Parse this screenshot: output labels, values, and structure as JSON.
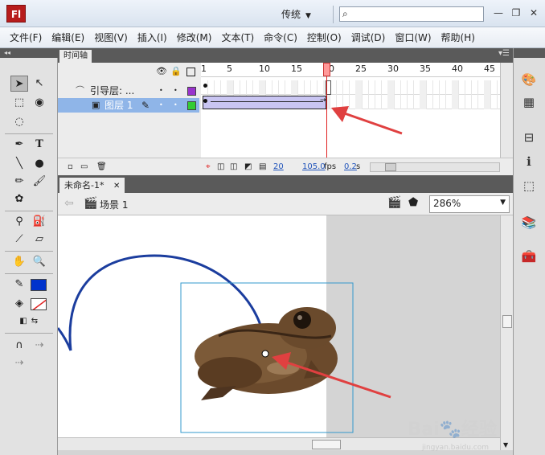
{
  "app": {
    "logo": "Fl",
    "workspace": "传统",
    "search_placeholder": ""
  },
  "menu": [
    "文件(F)",
    "编辑(E)",
    "视图(V)",
    "插入(I)",
    "修改(M)",
    "文本(T)",
    "命令(C)",
    "控制(O)",
    "调试(D)",
    "窗口(W)",
    "帮助(H)"
  ],
  "timeline": {
    "tab": "时间轴",
    "frame_numbers": [
      "1",
      "5",
      "10",
      "15",
      "20",
      "25",
      "30",
      "35",
      "40",
      "45"
    ],
    "playhead_frame": 20,
    "layers": [
      {
        "name": "引导层: ...",
        "type": "guide",
        "color": "#9933cc"
      },
      {
        "name": "图层 1",
        "type": "normal",
        "color": "#33cc33",
        "selected": true
      }
    ],
    "current_frame": "20",
    "fps": "105.0",
    "fps_unit": "fps",
    "time": "0.2",
    "time_unit": "s"
  },
  "document": {
    "tab": "未命名-1*",
    "scene": "场景 1",
    "zoom": "286%"
  },
  "colors": {
    "stroke": "#0033cc",
    "fill": "#ffffff",
    "path": "#1b3d9e",
    "arrow": "#e04040",
    "selection": "#3399cc"
  },
  "watermark": {
    "text": "Bai",
    "suffix": "经验",
    "url": "jingyan.baidu.com"
  }
}
